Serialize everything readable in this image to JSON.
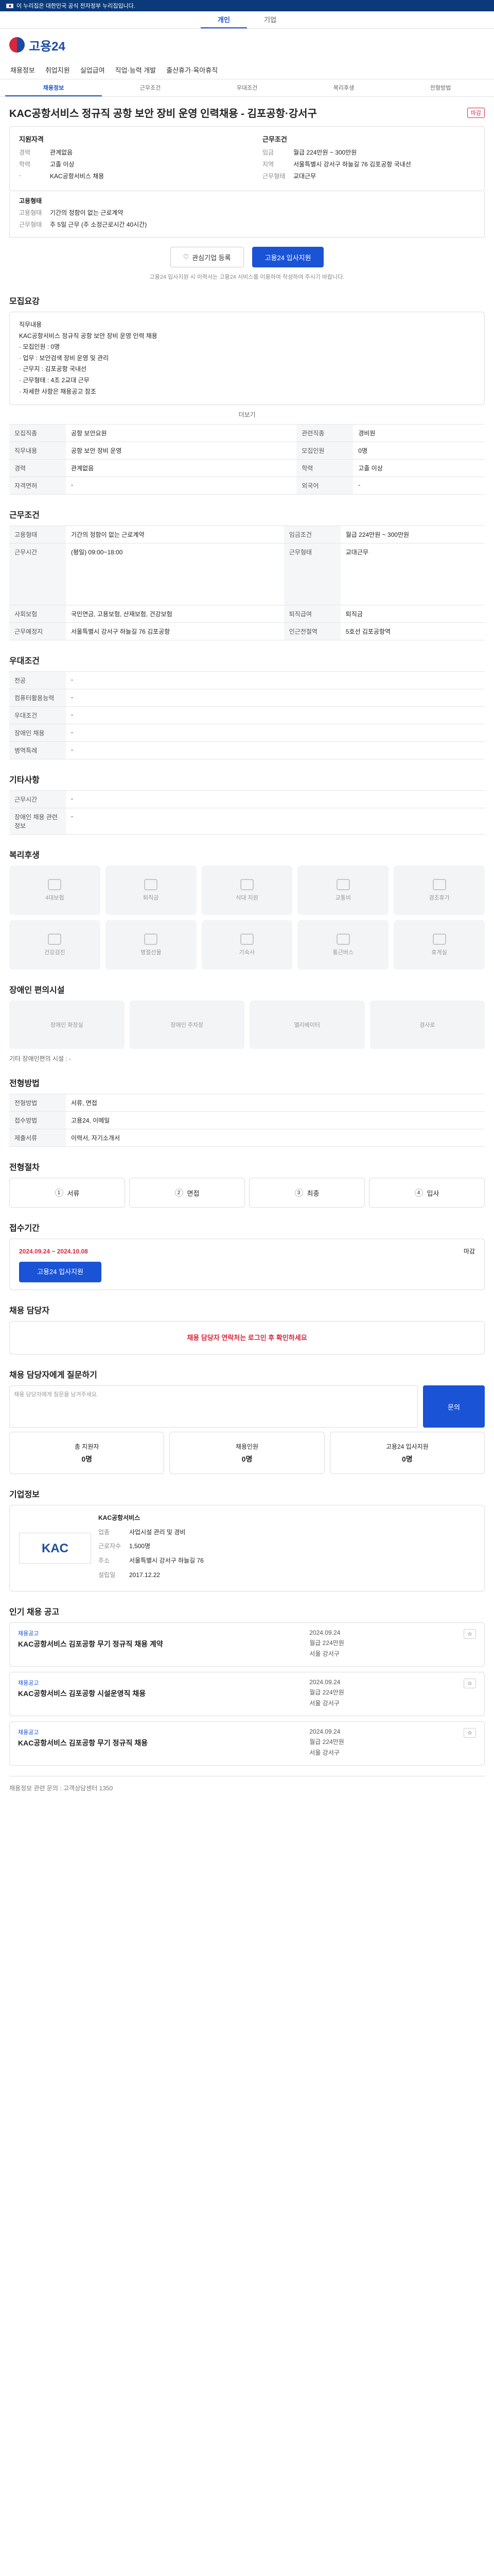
{
  "gov_banner": "이 누리집은 대한민국 공식 전자정부 누리집입니다.",
  "top_tabs": [
    "개인",
    "기업"
  ],
  "logo": "고용24",
  "gnb": [
    "채용정보",
    "취업지원",
    "실업급여",
    "직업·능력 개발",
    "출산휴가·육아휴직"
  ],
  "sub_tabs": [
    "채용정보",
    "근무조건",
    "우대조건",
    "복리후생",
    "전형방법"
  ],
  "title": "KAC공항서비스 정규직 공항 보안 장비 운영 인력채용 - 김포공항·강서구",
  "badge": "마감",
  "summary": {
    "left_head": "지원자격",
    "left": [
      [
        "경력",
        "관계없음"
      ],
      [
        "학력",
        "고졸 이상"
      ],
      [
        "-",
        "KAC공항서비스 채용"
      ]
    ],
    "right_head": "근무조건",
    "right": [
      [
        "임금",
        "월급 224만원 ~ 300만원"
      ],
      [
        "지역",
        "서울특별시 강서구 하늘길 76 김포공항 국내선"
      ],
      [
        "근무형태",
        "교대근무"
      ]
    ],
    "extra_head": "고용형태",
    "extra": [
      [
        "고용형태",
        "기간의 정함이 없는 근로계약"
      ],
      [
        "근무형태",
        "주 5일 근무 (주 소정근로시간 40시간)"
      ]
    ]
  },
  "buttons": {
    "interest": "관심기업 등록",
    "apply": "고용24 입사지원"
  },
  "apply_note": "고용24 입사지원 시 이력서는 고용24 서비스를 이용하여 작성하여 주시기 바랍니다.",
  "detail": {
    "title": "모집요강",
    "body": "직무내용\nKAC공항서비스 정규직 공항 보안 장비 운영 인력 채용\n· 모집인원 : 0명\n· 업무 : 보안검색 장비 운영 및 관리\n· 근무지 : 김포공항 국내선\n· 근무형태 : 4조 2교대 근무\n· 자세한 사항은 채용공고 참조",
    "more": "더보기"
  },
  "recruit_table": [
    [
      "모집직종",
      "공항 보안요원"
    ],
    [
      "관련직종",
      "경비원"
    ],
    [
      "직무내용",
      "공항 보안 장비 운영"
    ],
    [
      "모집인원",
      "0명"
    ],
    [
      "경력",
      "관계없음"
    ],
    [
      "학력",
      "고졸 이상"
    ],
    [
      "자격면허",
      "-"
    ],
    [
      "외국어",
      "-"
    ]
  ],
  "cond": {
    "title": "근무조건",
    "rows": [
      [
        "고용형태",
        "기간의 정함이 없는 근로계약"
      ],
      [
        "임금조건",
        "월급 224만원 ~ 300만원"
      ],
      [
        "근무시간",
        "(평일) 09:00~18:00"
      ],
      [
        "근무형태",
        "교대근무"
      ],
      [
        "사회보험",
        "국민연금, 고용보험, 산재보험, 건강보험"
      ],
      [
        "퇴직급여",
        "퇴직금"
      ],
      [
        "근무예정지",
        "서울특별시 강서구 하늘길 76 김포공항"
      ],
      [
        "인근전철역",
        "5호선 김포공항역"
      ]
    ]
  },
  "pref": {
    "title": "우대조건",
    "rows": [
      [
        "전공",
        "-"
      ],
      [
        "컴퓨터활용능력",
        "-"
      ],
      [
        "우대조건",
        "-"
      ],
      [
        "장애인 채용",
        "-"
      ],
      [
        "병역특례",
        "-"
      ]
    ]
  },
  "etc_title": "기타사항",
  "etc_rows": [
    [
      "근무시간",
      "-"
    ],
    [
      "장애인 채용 관련 정보",
      "-"
    ]
  ],
  "welfare": {
    "title": "복리후생",
    "items": [
      "4대보험",
      "퇴직금",
      "식대 지원",
      "교통비",
      "경조휴가",
      "건강검진",
      "명절선물",
      "기숙사",
      "통근버스",
      "휴게실"
    ]
  },
  "disability": {
    "title": "장애인 편의시설",
    "items": [
      "장애인 화장실",
      "장애인 주차장",
      "엘리베이터",
      "경사로"
    ],
    "note": "기타 장애인편의 시설 : -"
  },
  "select": {
    "title": "전형방법",
    "rows": [
      [
        "전형방법",
        "서류, 면접"
      ],
      [
        "접수방법",
        "고용24, 이메일"
      ],
      [
        "제출서류",
        "이력서, 자기소개서"
      ]
    ]
  },
  "steps_title": "전형절차",
  "steps": [
    "서류",
    "면접",
    "최종",
    "입사"
  ],
  "apply_period": {
    "title": "접수기간",
    "from": "2024.09.24",
    "to": "2024.10.08",
    "status": "마감"
  },
  "contact_title": "채용 담당자",
  "contact_alert": "채용 담당자 연락처는 로그인 후 확인하세요",
  "qna": {
    "title": "채용 담당자에게 질문하기",
    "placeholder": "채용 담당자에게 질문을 남겨주세요.",
    "btn": "문의"
  },
  "three": [
    [
      "총 지원자",
      "0명"
    ],
    [
      "채용인원",
      "0명"
    ],
    [
      "고용24 입사지원",
      "0명"
    ]
  ],
  "company": {
    "title": "기업정보",
    "name": "KAC공항서비스",
    "logo": "KAC",
    "rows": [
      [
        "업종",
        "사업시설 관리 및 경비"
      ],
      [
        "근로자수",
        "1,500명"
      ],
      [
        "주소",
        "서울특별시 강서구 하늘길 76"
      ],
      [
        "설립일",
        "2017.12.22"
      ]
    ]
  },
  "jobs_title": "인기 채용 공고",
  "jobs": [
    {
      "tag": "채용공고",
      "title": "KAC공항서비스 김포공항 무기 정규직 채용 계약",
      "date": "2024.09.24",
      "wage": "월급 224만원",
      "loc": "서울 강서구"
    },
    {
      "tag": "채용공고",
      "title": "KAC공항서비스 김포공항 시설운영직 채용",
      "date": "2024.09.24",
      "wage": "월급 224만원",
      "loc": "서울 강서구"
    },
    {
      "tag": "채용공고",
      "title": "KAC공항서비스 김포공항 무기 정규직 채용",
      "date": "2024.09.24",
      "wage": "월급 224만원",
      "loc": "서울 강서구"
    }
  ],
  "footer_note": "채용정보 관련 문의 : 고객상담센터 1350"
}
